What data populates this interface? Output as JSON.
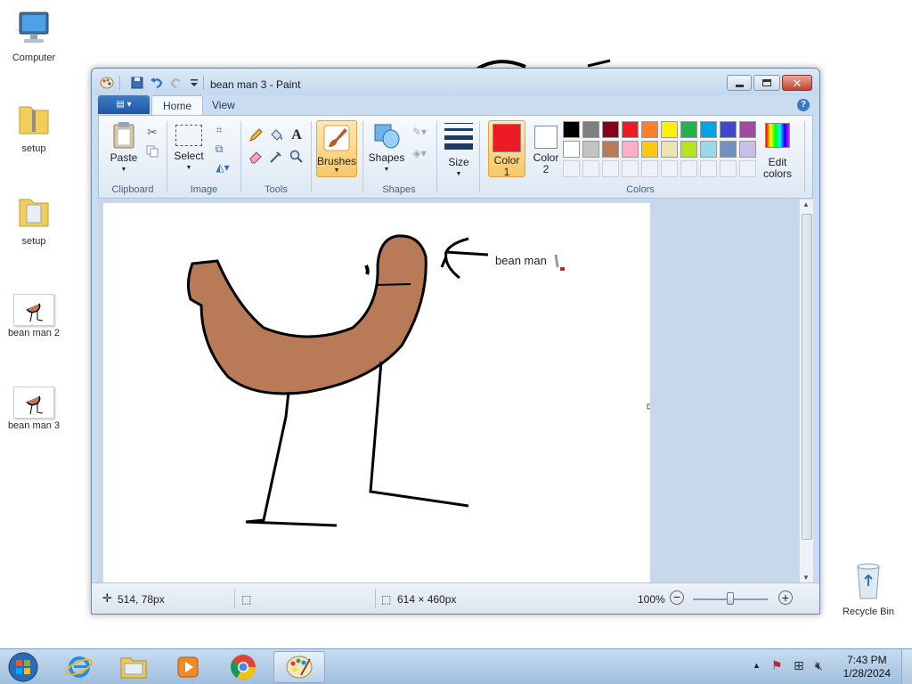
{
  "desktop": {
    "icons": [
      {
        "label": "Computer"
      },
      {
        "label": "setup"
      },
      {
        "label": "setup"
      },
      {
        "label": "bean man 2"
      },
      {
        "label": "bean man 3"
      },
      {
        "label": "Recycle Bin"
      }
    ]
  },
  "window": {
    "title": "bean man 3 - Paint",
    "tabs": [
      {
        "label": "Home",
        "active": true
      },
      {
        "label": "View",
        "active": false
      }
    ],
    "help": "?"
  },
  "ribbon": {
    "clipboard": {
      "paste_label": "Paste",
      "group_label": "Clipboard"
    },
    "image": {
      "select_label": "Select",
      "group_label": "Image"
    },
    "tools": {
      "group_label": "Tools"
    },
    "brushes": {
      "label": "Brushes"
    },
    "shapes": {
      "label": "Shapes",
      "group_label": "Shapes"
    },
    "size": {
      "label": "Size"
    },
    "colors": {
      "color1_label": "Color",
      "color1_num": "1",
      "color2_label": "Color",
      "color2_num": "2",
      "edit_label_1": "Edit",
      "edit_label_2": "colors",
      "group_label": "Colors",
      "color1": "#ed1c24",
      "color2": "#ffffff",
      "palette_row1": [
        "#000000",
        "#7f7f7f",
        "#880015",
        "#ed1c24",
        "#ff7f27",
        "#fff200",
        "#22b14c",
        "#00a2e8",
        "#3f48cc",
        "#a349a4"
      ],
      "palette_row2": [
        "#ffffff",
        "#c3c3c3",
        "#b97a57",
        "#ffaec9",
        "#ffc90e",
        "#efe4b0",
        "#b5e61d",
        "#99d9ea",
        "#7092be",
        "#c8bfe7"
      ]
    }
  },
  "canvas": {
    "text": "bean man",
    "fill_color": "#b97a57"
  },
  "status": {
    "cursor_pos": "514, 78px",
    "image_size": "614 × 460px",
    "zoom": "100%"
  },
  "taskbar": {
    "time": "7:43 PM",
    "date": "1/28/2024"
  }
}
